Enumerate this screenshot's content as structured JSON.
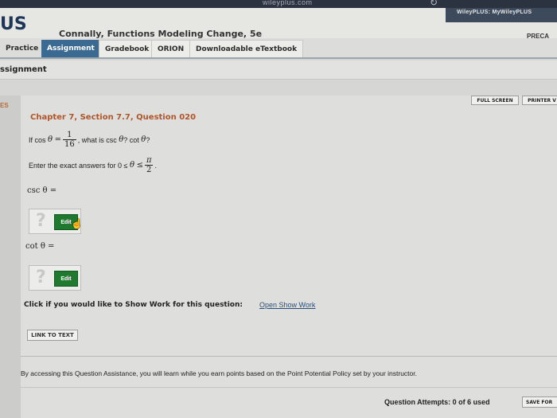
{
  "browser": {
    "url_text": "wileyplus.com",
    "wiley_links": "WileyPLUS: MyWileyPLUS"
  },
  "header": {
    "logo": "US",
    "book_title": "Connally, Functions Modeling Change, 5e",
    "preca_link": "PRECA"
  },
  "tabs": [
    {
      "label": "Practice",
      "active": false
    },
    {
      "label": "Assignment",
      "active": true
    },
    {
      "label": "Gradebook",
      "active": false
    },
    {
      "label": "ORION",
      "active": false
    },
    {
      "label": "Downloadable eTextbook",
      "active": false
    }
  ],
  "page": {
    "title": "ssignment",
    "left_label": "ES"
  },
  "toolbar": {
    "full_screen": "FULL SCREEN",
    "printer": "PRINTER V"
  },
  "question": {
    "heading": "Chapter 7, Section 7.7, Question 020",
    "prompt_if": "If cos",
    "theta": "θ",
    "equals": "=",
    "frac_num": "1",
    "frac_den": "16",
    "prompt_rest": ", what is csc",
    "q_mark_cot": "? cot",
    "q_end": "?",
    "exact_prefix": "Enter the exact answers for 0 ≤",
    "le": "≤",
    "pi": "π",
    "two": "2",
    "period": ".",
    "csc_label": "csc θ =",
    "cot_label": "cot θ ="
  },
  "answers": {
    "question_mark": "?",
    "edit_label": "Edit"
  },
  "footer": {
    "show_work_prompt": "Click if you would like to Show Work for this question:",
    "show_work_link": "Open Show Work",
    "link_to_text": "LINK TO TEXT",
    "policy": "By accessing this Question Assistance, you will learn while you earn points based on the Point Potential Policy set by your instructor.",
    "attempts": "Question Attempts: 0 of 6 used",
    "save_button": "SAVE FOR"
  }
}
